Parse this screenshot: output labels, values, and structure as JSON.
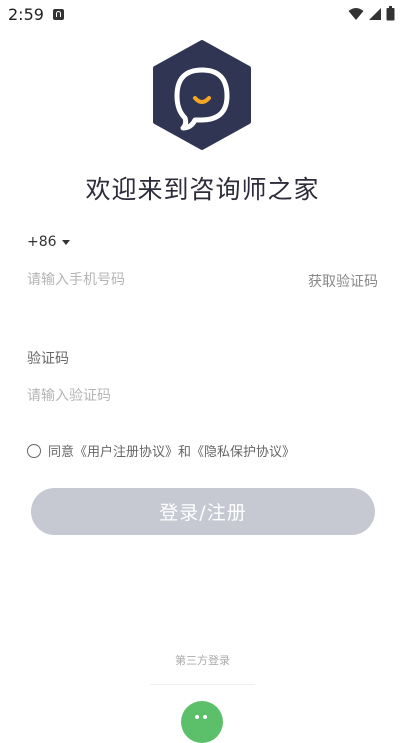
{
  "status_bar": {
    "time": "2:59"
  },
  "welcome": "欢迎来到咨询师之家",
  "phone": {
    "country_code": "+86",
    "placeholder": "请输入手机号码",
    "get_code_label": "获取验证码"
  },
  "code": {
    "label": "验证码",
    "placeholder": "请输入验证码"
  },
  "agreement": {
    "text": "同意《用户注册协议》和《隐私保护协议》",
    "checked": false
  },
  "login_button": "登录/注册",
  "third_party_label": "第三方登录",
  "icons": {
    "logo": "chat-bubble-hexagon-logo",
    "third_party": "wechat-icon"
  },
  "colors": {
    "logo_bg": "#2f3552",
    "button_disabled": "#c6c8d2",
    "accent": "#f5a623",
    "wechat": "#5cbf6a"
  }
}
